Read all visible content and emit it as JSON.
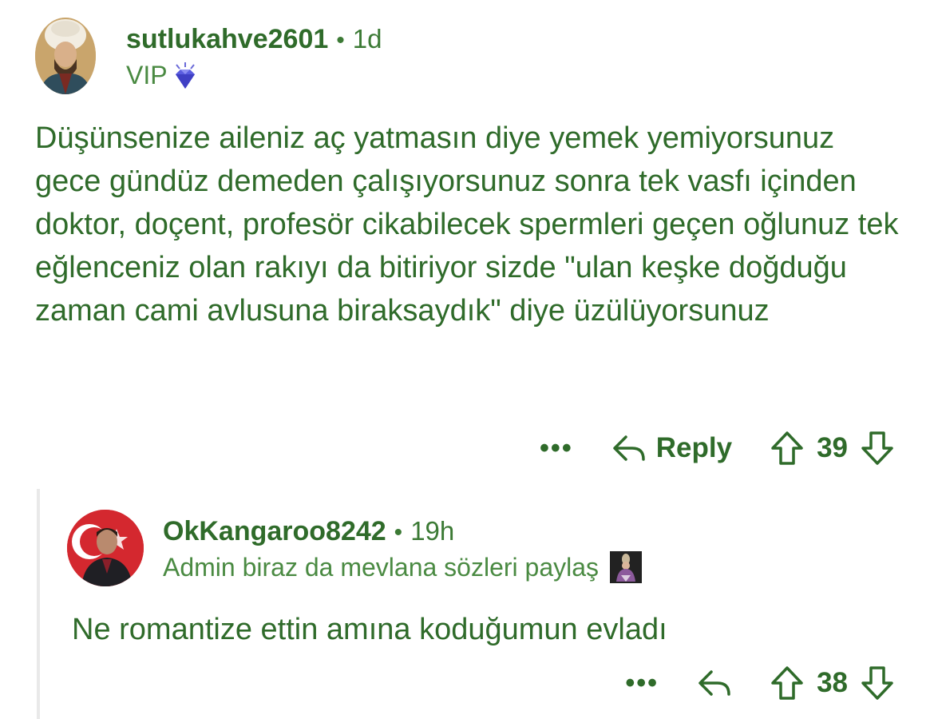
{
  "comments": [
    {
      "username": "sutlukahve2601",
      "separator": "•",
      "time": "1d",
      "flair": "VIP",
      "flair_icon": "diamond-icon",
      "body": "Düşünsenize aileniz aç yatmasın diye yemek yemiyorsunuz gece gündüz demeden çalışıyorsunuz sonra tek vasfı içinden doktor, doçent, profesör cikabilecek spermleri geçen oğlunuz tek eğlenceniz olan rakıyı da bitiriyor sizde \"ulan keşke doğduğu zaman cami avlusuna biraksaydık\" diye üzülüyorsunuz",
      "actions": {
        "more": "•••",
        "reply_label": "Reply",
        "score": "39"
      }
    },
    {
      "username": "OkKangaroo8242",
      "separator": "•",
      "time": "19h",
      "flair": "Admin biraz da mevlana sözleri paylaş",
      "flair_icon": "mevlana-icon",
      "body": "Ne romantize ettin amına koduğumun evladı",
      "actions": {
        "more": "•••",
        "score": "38"
      }
    }
  ],
  "colors": {
    "text": "#2f6b2a",
    "flair": "#4a8a42",
    "thread_line": "#e9e9e9",
    "background": "#ffffff"
  }
}
